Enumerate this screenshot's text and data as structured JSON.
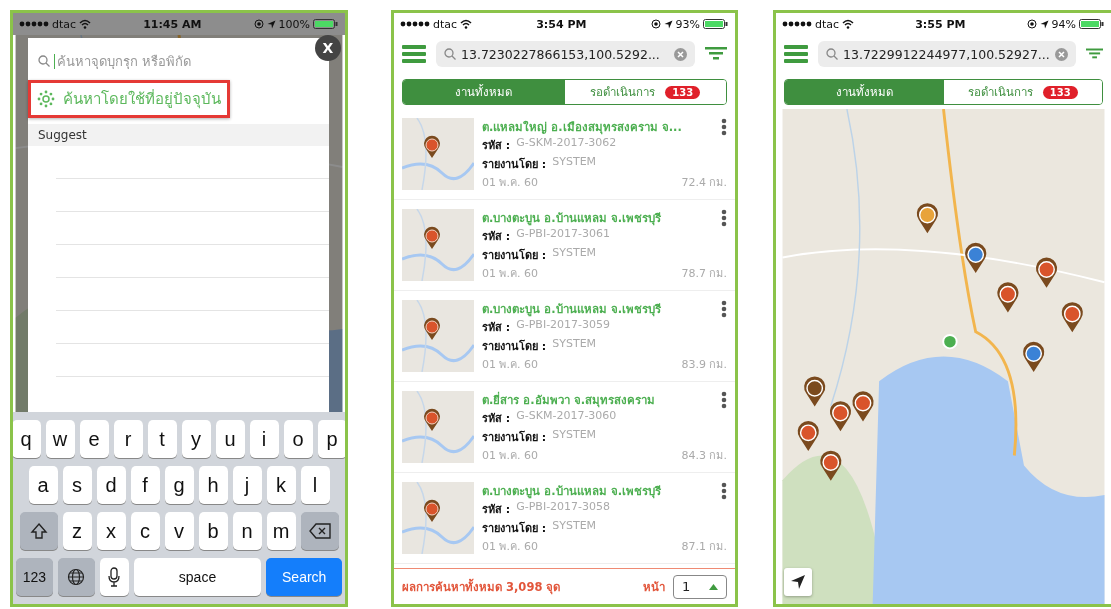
{
  "screens": [
    {
      "kind": "search",
      "status_bar": {
        "carrier": "dtac",
        "time": "11:45 AM",
        "battery": "100%"
      },
      "close_button": "X",
      "search": {
        "placeholder": "ค้นหาจุดบุกรุก หรือพิกัด"
      },
      "current_location": {
        "label": "ค้นหาโดยใช้ที่อยู่ปัจจุบัน",
        "highlighted": true
      },
      "suggest_header": "Suggest",
      "keyboard": [
        [
          {
            "kind": "char",
            "label": "q"
          },
          {
            "kind": "char",
            "label": "w"
          },
          {
            "kind": "char",
            "label": "e"
          },
          {
            "kind": "char",
            "label": "r"
          },
          {
            "kind": "char",
            "label": "t"
          },
          {
            "kind": "char",
            "label": "y"
          },
          {
            "kind": "char",
            "label": "u"
          },
          {
            "kind": "char",
            "label": "i"
          },
          {
            "kind": "char",
            "label": "o"
          },
          {
            "kind": "char",
            "label": "p"
          }
        ],
        [
          {
            "kind": "char",
            "label": "a"
          },
          {
            "kind": "char",
            "label": "s"
          },
          {
            "kind": "char",
            "label": "d"
          },
          {
            "kind": "char",
            "label": "f"
          },
          {
            "kind": "char",
            "label": "g"
          },
          {
            "kind": "char",
            "label": "h"
          },
          {
            "kind": "char",
            "label": "j"
          },
          {
            "kind": "char",
            "label": "k"
          },
          {
            "kind": "char",
            "label": "l"
          }
        ],
        [
          {
            "kind": "shift"
          },
          {
            "kind": "char",
            "label": "z"
          },
          {
            "kind": "char",
            "label": "x"
          },
          {
            "kind": "char",
            "label": "c"
          },
          {
            "kind": "char",
            "label": "v"
          },
          {
            "kind": "char",
            "label": "b"
          },
          {
            "kind": "char",
            "label": "n"
          },
          {
            "kind": "char",
            "label": "m"
          },
          {
            "kind": "delete"
          }
        ],
        [
          {
            "kind": "numbers",
            "label": "123"
          },
          {
            "kind": "globe"
          },
          {
            "kind": "mic"
          },
          {
            "kind": "space",
            "label": "space"
          },
          {
            "kind": "search",
            "label": "Search"
          }
        ]
      ]
    },
    {
      "kind": "list",
      "status_bar": {
        "carrier": "dtac",
        "time": "3:54 PM",
        "battery": "93%"
      },
      "search": {
        "value": "13.7230227866153,100.5292..."
      },
      "tabs": [
        {
          "label": "งานทั้งหมด",
          "selected": true
        },
        {
          "label": "รอดำเนินการ",
          "selected": false,
          "badge": "133"
        }
      ],
      "items": [
        {
          "title": "ต.แหลมใหญ่ อ.เมืองสมุทรสงคราม จ...",
          "code_label": "รหัส :",
          "code": "G-SKM-2017-3062",
          "reporter_label": "รายงานโดย :",
          "reporter": "SYSTEM",
          "date": "01 พ.ค. 60",
          "distance": "72.4 กม."
        },
        {
          "title": "ต.บางตะบูน อ.บ้านแหลม จ.เพชรบุรี",
          "code_label": "รหัส :",
          "code": "G-PBI-2017-3061",
          "reporter_label": "รายงานโดย :",
          "reporter": "SYSTEM",
          "date": "01 พ.ค. 60",
          "distance": "78.7 กม."
        },
        {
          "title": "ต.บางตะบูน อ.บ้านแหลม จ.เพชรบุรี",
          "code_label": "รหัส :",
          "code": "G-PBI-2017-3059",
          "reporter_label": "รายงานโดย :",
          "reporter": "SYSTEM",
          "date": "01 พ.ค. 60",
          "distance": "83.9 กม."
        },
        {
          "title": "ต.ยี่สาร อ.อัมพวา จ.สมุทรสงคราม",
          "code_label": "รหัส :",
          "code": "G-SKM-2017-3060",
          "reporter_label": "รายงานโดย :",
          "reporter": "SYSTEM",
          "date": "01 พ.ค. 60",
          "distance": "84.3 กม."
        },
        {
          "title": "ต.บางตะบูน อ.บ้านแหลม จ.เพชรบุรี",
          "code_label": "รหัส :",
          "code": "G-PBI-2017-3058",
          "reporter_label": "รายงานโดย :",
          "reporter": "SYSTEM",
          "date": "01 พ.ค. 60",
          "distance": "87.1 กม."
        }
      ],
      "footer": {
        "total": "ผลการค้นหาทั้งหมด 3,098 จุด",
        "page_label": "หน้า",
        "page": "1"
      }
    },
    {
      "kind": "map",
      "status_bar": {
        "carrier": "dtac",
        "time": "3:55 PM",
        "battery": "94%"
      },
      "search": {
        "value": "13.7229912244977,100.52927..."
      },
      "tabs": [
        {
          "label": "งานทั้งหมด",
          "selected": true
        },
        {
          "label": "รอดำเนินการ",
          "selected": false,
          "badge": "133"
        }
      ]
    }
  ]
}
